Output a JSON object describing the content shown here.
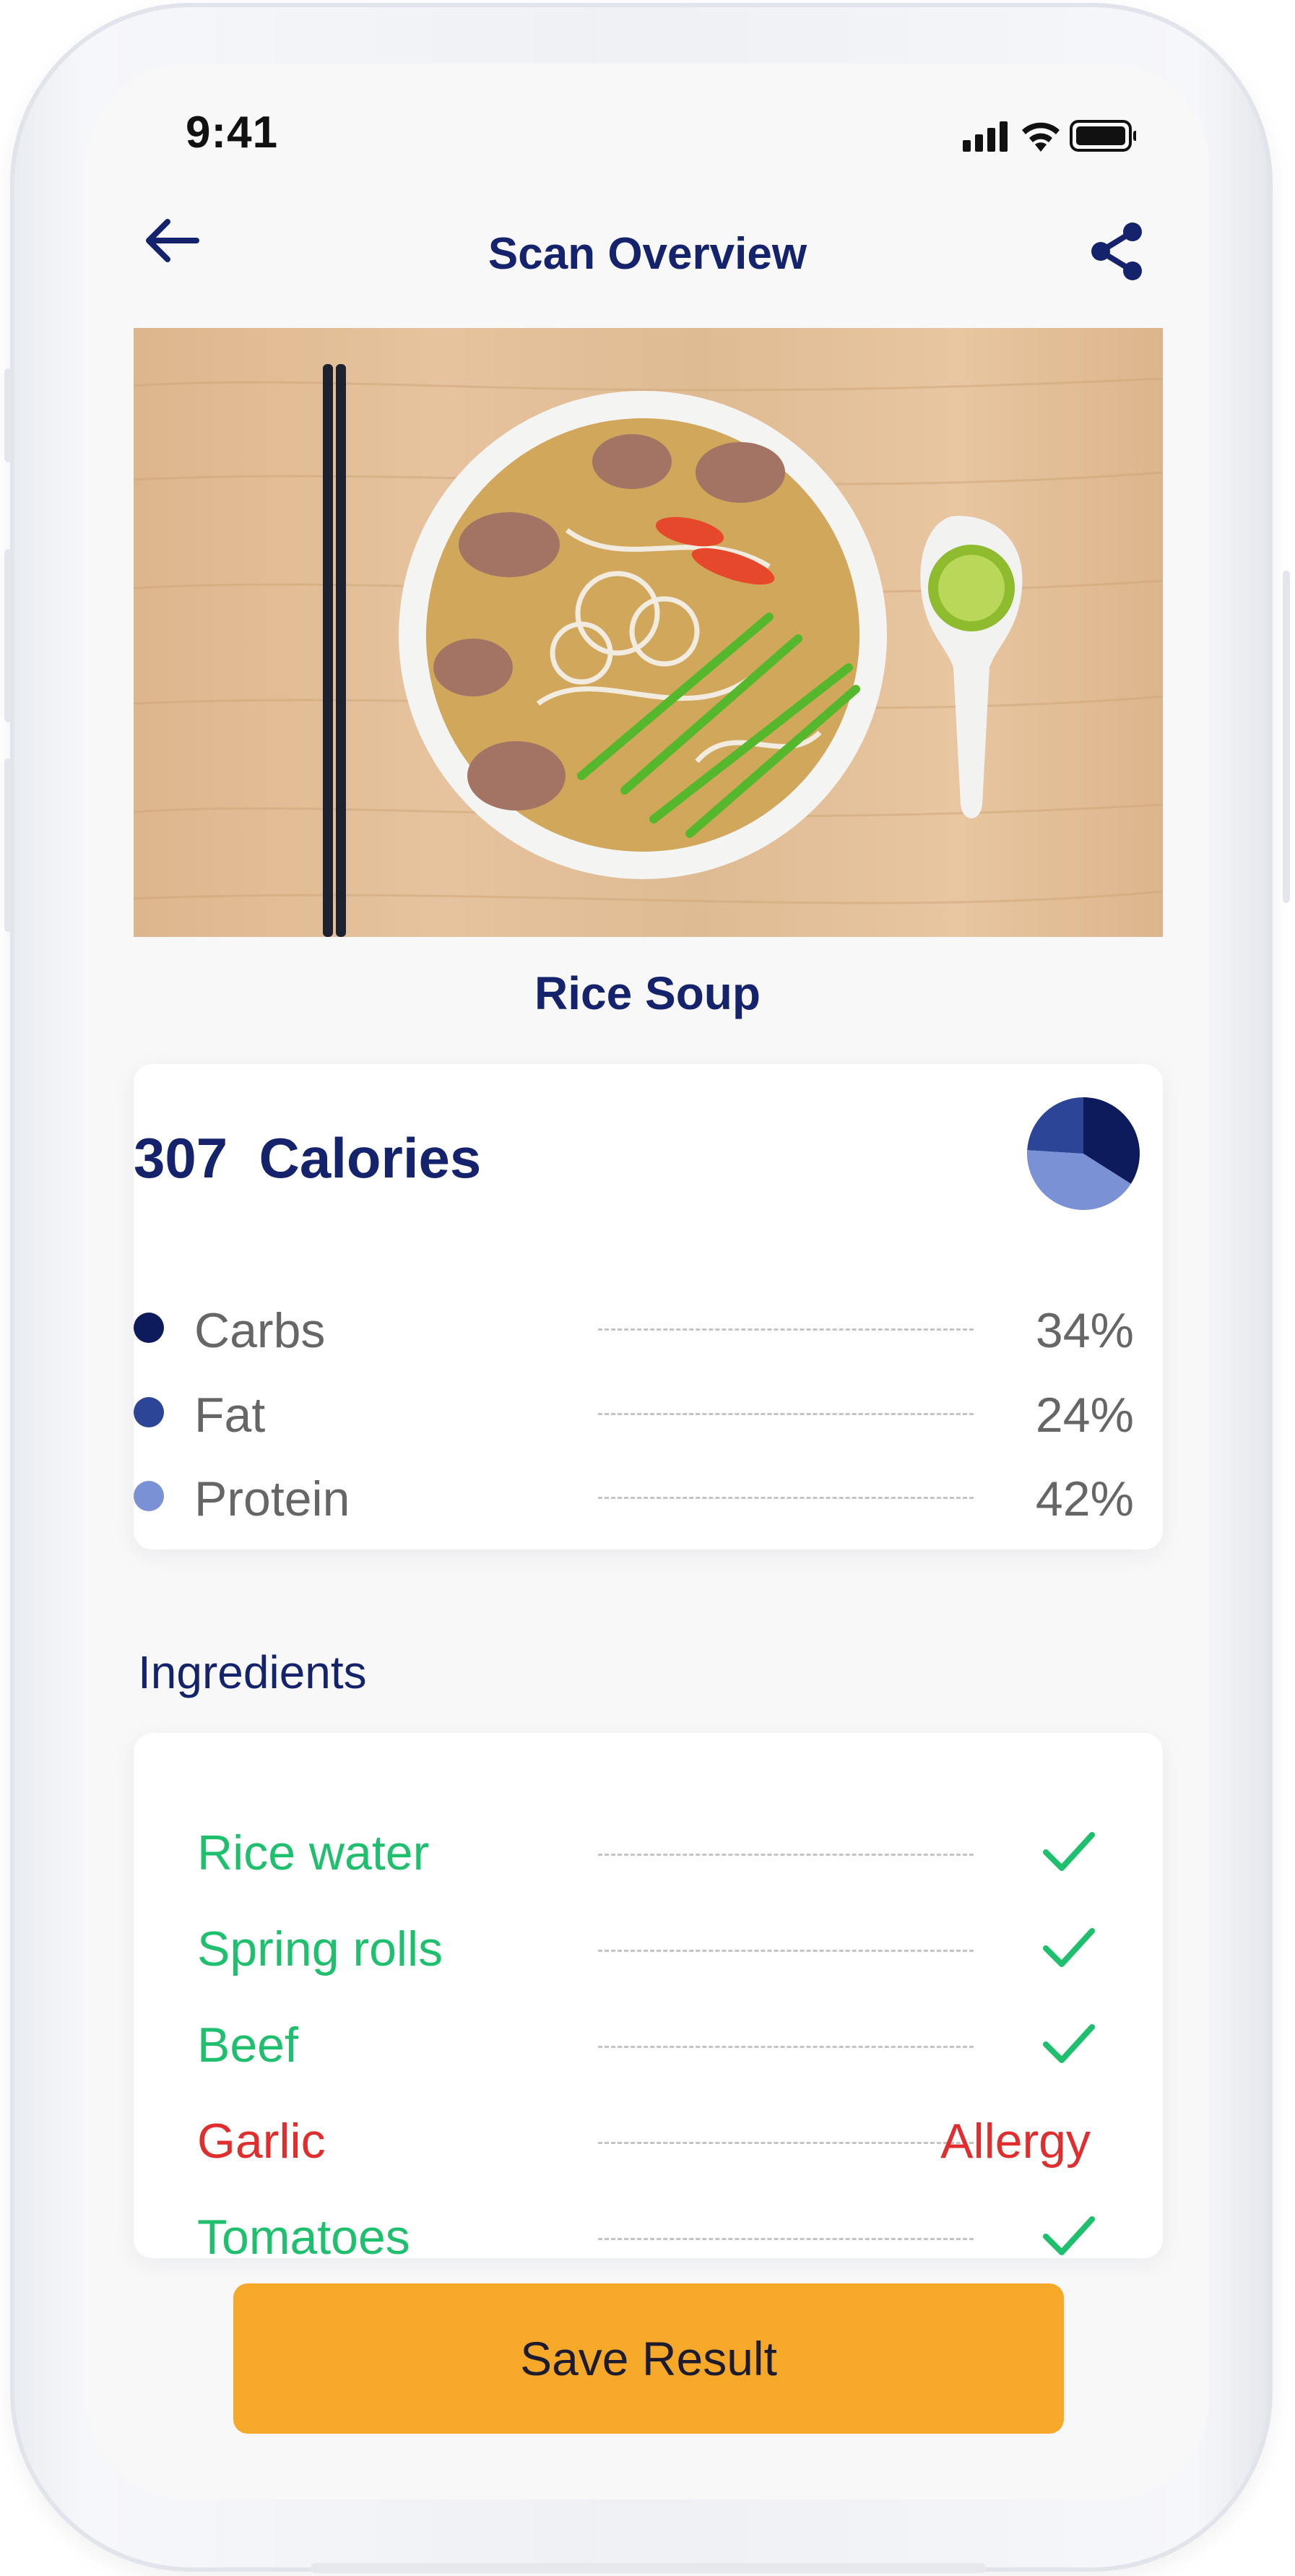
{
  "status_bar": {
    "time": "9:41"
  },
  "header": {
    "title": "Scan Overview",
    "back_icon": "arrow-left-icon",
    "share_icon": "share-icon"
  },
  "photo": {
    "alt": "bowl-of-rice-soup-photo"
  },
  "dish": {
    "name": "Rice Soup"
  },
  "calories": {
    "value": "307",
    "unit": "Calories",
    "macros": [
      {
        "label": "Carbs",
        "percent": "34%",
        "fraction": 0.34,
        "color": "#0d1a5c"
      },
      {
        "label": "Fat",
        "percent": "24%",
        "fraction": 0.24,
        "color": "#2d4596"
      },
      {
        "label": "Protein",
        "percent": "42%",
        "fraction": 0.42,
        "color": "#7a91d6"
      }
    ]
  },
  "ingredients": {
    "heading": "Ingredients",
    "items": [
      {
        "label": "Rice water",
        "status": "ok"
      },
      {
        "label": "Spring rolls",
        "status": "ok"
      },
      {
        "label": "Beef",
        "status": "ok"
      },
      {
        "label": "Garlic",
        "status": "Allergy"
      },
      {
        "label": "Tomatoes",
        "status": "ok"
      }
    ]
  },
  "actions": {
    "save_label": "Save Result"
  },
  "colors": {
    "navy": "#14236b",
    "accent": "#f6a828",
    "ok": "#1ebf6d",
    "allergy": "#e02d2d"
  }
}
